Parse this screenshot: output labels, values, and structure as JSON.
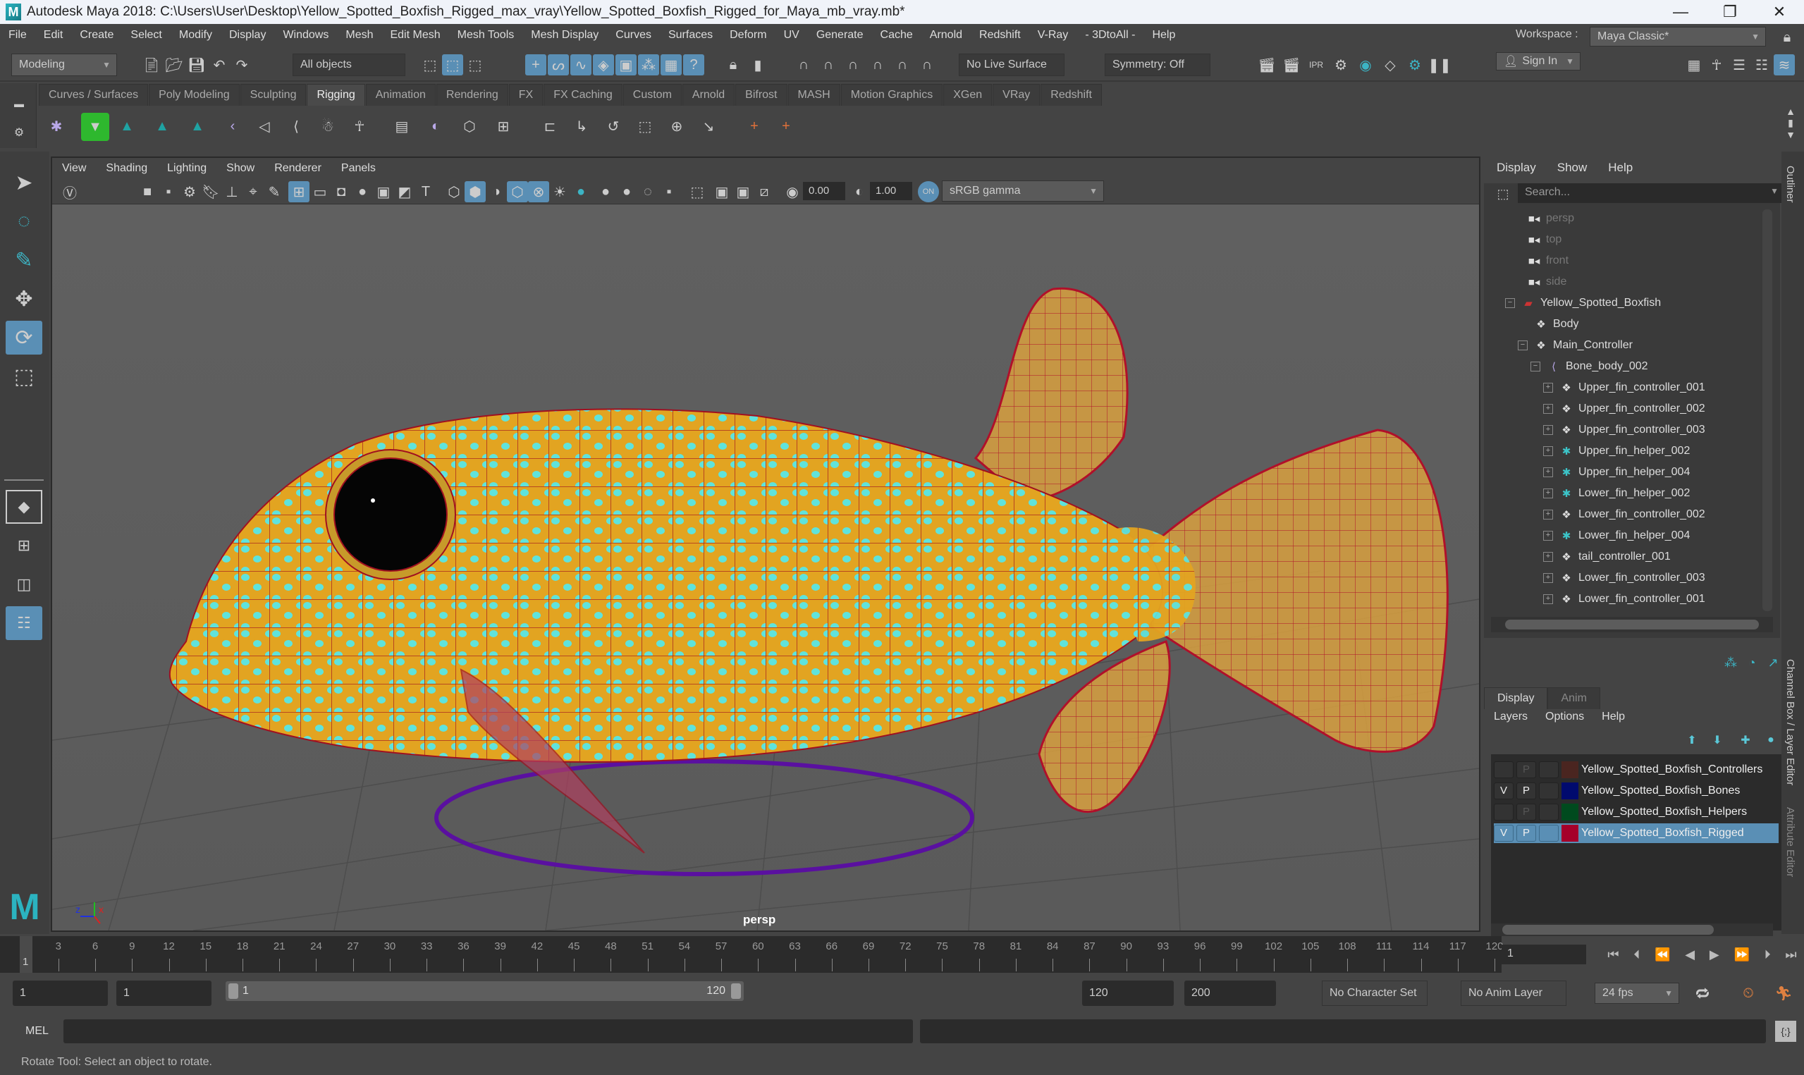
{
  "titlebar": {
    "app_title": "Autodesk Maya 2018: C:\\Users\\User\\Desktop\\Yellow_Spotted_Boxfish_Rigged_max_vray\\Yellow_Spotted_Boxfish_Rigged_for_Maya_mb_vray.mb*",
    "minimize": "—",
    "restore": "❐",
    "close": "✕"
  },
  "menubar": [
    "File",
    "Edit",
    "Create",
    "Select",
    "Modify",
    "Display",
    "Windows",
    "Mesh",
    "Edit Mesh",
    "Mesh Tools",
    "Mesh Display",
    "Curves",
    "Surfaces",
    "Deform",
    "UV",
    "Generate",
    "Cache",
    "Arnold",
    "Redshift",
    "V-Ray",
    "- 3DtoAll -",
    "Help"
  ],
  "statusline": {
    "menuset": "Modeling",
    "selection_mask": "All objects",
    "live_surface": "No Live Surface",
    "symmetry": "Symmetry: Off",
    "sign_in": "Sign In",
    "workspace_label": "Workspace :",
    "workspace_value": "Maya Classic*"
  },
  "shelf": {
    "tabs": [
      "Curves / Surfaces",
      "Poly Modeling",
      "Sculpting",
      "Rigging",
      "Animation",
      "Rendering",
      "FX",
      "FX Caching",
      "Custom",
      "Arnold",
      "Bifrost",
      "MASH",
      "Motion Graphics",
      "XGen",
      "VRay",
      "Redshift"
    ],
    "active_tab": "Rigging"
  },
  "viewport": {
    "menus": [
      "View",
      "Shading",
      "Lighting",
      "Show",
      "Renderer",
      "Panels"
    ],
    "exposure": "0.00",
    "gamma": "1.00",
    "color_space": "sRGB gamma",
    "camera_name": "persp"
  },
  "outliner": {
    "menus": [
      "Display",
      "Show",
      "Help"
    ],
    "search_placeholder": "Search...",
    "side_tab": "Outliner",
    "items": [
      {
        "label": "persp",
        "icon": "camera-icon",
        "depth": 0,
        "dim": true
      },
      {
        "label": "top",
        "icon": "camera-icon",
        "depth": 0,
        "dim": true
      },
      {
        "label": "front",
        "icon": "camera-icon",
        "depth": 0,
        "dim": true
      },
      {
        "label": "side",
        "icon": "camera-icon",
        "depth": 0,
        "dim": true
      },
      {
        "label": "Yellow_Spotted_Boxfish",
        "icon": "set-icon",
        "depth": 0,
        "expander": "−"
      },
      {
        "label": "Body",
        "icon": "transform-icon",
        "depth": 1
      },
      {
        "label": "Main_Controller",
        "icon": "transform-icon",
        "depth": 1,
        "expander": "−"
      },
      {
        "label": "Bone_body_002",
        "icon": "joint-icon",
        "depth": 2,
        "expander": "−"
      },
      {
        "label": "Upper_fin_controller_001",
        "icon": "transform-icon",
        "depth": 3,
        "expander": "+"
      },
      {
        "label": "Upper_fin_controller_002",
        "icon": "transform-icon",
        "depth": 3,
        "expander": "+"
      },
      {
        "label": "Upper_fin_controller_003",
        "icon": "transform-icon",
        "depth": 3,
        "expander": "+"
      },
      {
        "label": "Upper_fin_helper_002",
        "icon": "locator-icon",
        "depth": 3,
        "expander": "+"
      },
      {
        "label": "Upper_fin_helper_004",
        "icon": "locator-icon",
        "depth": 3,
        "expander": "+"
      },
      {
        "label": "Lower_fin_helper_002",
        "icon": "locator-icon",
        "depth": 3,
        "expander": "+"
      },
      {
        "label": "Lower_fin_controller_002",
        "icon": "transform-icon",
        "depth": 3,
        "expander": "+"
      },
      {
        "label": "Lower_fin_helper_004",
        "icon": "locator-icon",
        "depth": 3,
        "expander": "+"
      },
      {
        "label": "tail_controller_001",
        "icon": "transform-icon",
        "depth": 3,
        "expander": "+"
      },
      {
        "label": "Lower_fin_controller_003",
        "icon": "transform-icon",
        "depth": 3,
        "expander": "+"
      },
      {
        "label": "Lower_fin_controller_001",
        "icon": "transform-icon",
        "depth": 3,
        "expander": "+"
      }
    ]
  },
  "layer_editor": {
    "side_tab": "Channel Box / Layer Editor",
    "side_tab2": "Attribute Editor",
    "tabs": [
      "Display",
      "Anim"
    ],
    "menus": [
      "Layers",
      "Options",
      "Help"
    ],
    "layers": [
      {
        "name": "Yellow_Spotted_Boxfish_Controllers",
        "v": "",
        "p": "P",
        "color": "#4a2520",
        "selected": false,
        "p_dim": true
      },
      {
        "name": "Yellow_Spotted_Boxfish_Bones",
        "v": "V",
        "p": "P",
        "color": "#000a6e",
        "selected": false,
        "p_dim": false
      },
      {
        "name": "Yellow_Spotted_Boxfish_Helpers",
        "v": "",
        "p": "P",
        "color": "#004a1e",
        "selected": false,
        "p_dim": true
      },
      {
        "name": "Yellow_Spotted_Boxfish_Rigged",
        "v": "V",
        "p": "P",
        "color": "#a5002a",
        "selected": true,
        "p_dim": false
      }
    ]
  },
  "timeline": {
    "start": 1,
    "end": 120,
    "step": 3,
    "current_frame": "1",
    "current_marker": "1"
  },
  "range": {
    "start_field": "1",
    "start_playback": "1",
    "slider_start": "1",
    "slider_end": "120",
    "end_playback": "120",
    "end_field": "200",
    "character_set": "No Character Set",
    "anim_layer": "No Anim Layer",
    "fps": "24 fps"
  },
  "command_line": {
    "language": "MEL",
    "value": ""
  },
  "help_line": "Rotate Tool: Select an object to rotate.",
  "colors": {
    "accent_blue": "#5a8fb5",
    "fish_body": "#e8a820",
    "fish_spots": "#5ce0e0",
    "wire": "#a01020",
    "controller_ring": "#5a10a0"
  }
}
